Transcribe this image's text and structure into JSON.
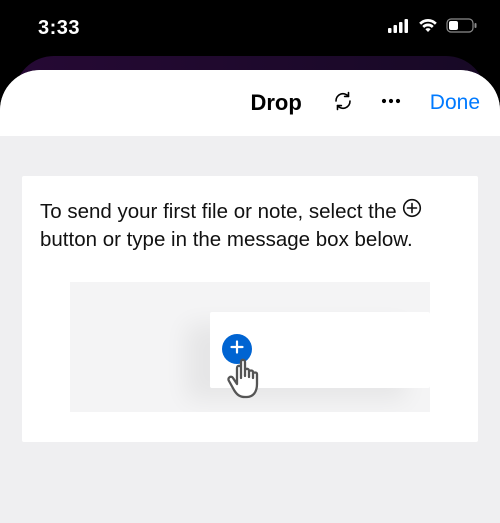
{
  "status": {
    "time": "3:33"
  },
  "nav": {
    "title": "Drop",
    "done": "Done"
  },
  "card": {
    "instruction_pre": "To send your first file or note, select the ",
    "instruction_post": " button or type in the message box below."
  }
}
